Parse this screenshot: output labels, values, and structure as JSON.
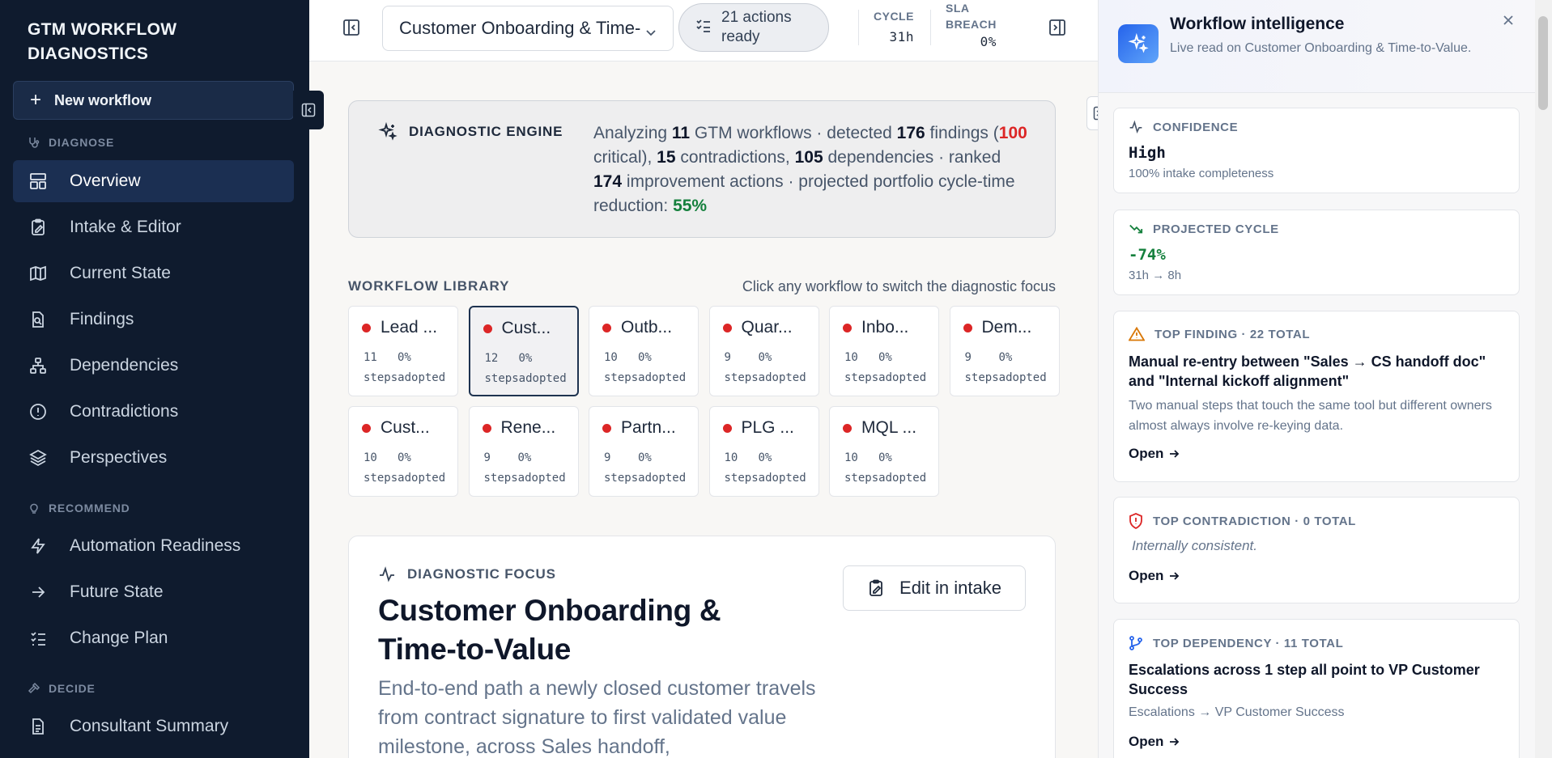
{
  "sidebar": {
    "brand_line1": "GTM WORKFLOW",
    "brand_line2": "DIAGNOSTICS",
    "new_workflow": "New workflow",
    "sections": {
      "diagnose": "DIAGNOSE",
      "recommend": "RECOMMEND",
      "decide": "DECIDE"
    },
    "items": {
      "overview": "Overview",
      "intake": "Intake & Editor",
      "current_state": "Current State",
      "findings": "Findings",
      "dependencies": "Dependencies",
      "contradictions": "Contradictions",
      "perspectives": "Perspectives",
      "automation": "Automation Readiness",
      "future_state": "Future State",
      "change_plan": "Change Plan",
      "consultant_summary": "Consultant Summary"
    }
  },
  "topbar": {
    "workflow_select": "Customer Onboarding & Time-",
    "actions_line1": "21 actions",
    "actions_line2": "ready",
    "cycle_label": "CYCLE",
    "cycle_value": "31h",
    "sla_label_1": "SLA",
    "sla_label_2": "BREACH",
    "sla_value": "0%"
  },
  "engine": {
    "label": "DIAGNOSTIC ENGINE",
    "t1": "Analyzing ",
    "workflows": "11",
    "t2": " GTM workflows · detected ",
    "findings": "176",
    "t3": " findings (",
    "critical": "100",
    "t4": " critical), ",
    "contradictions": "15",
    "t5": " contradictions, ",
    "dependencies": "105",
    "t6": " dependencies · ranked ",
    "actions": "174",
    "t7": " improvement actions · projected portfolio cycle-time reduction: ",
    "reduction": "55%"
  },
  "library": {
    "heading": "WORKFLOW LIBRARY",
    "hint": "Click any workflow to switch the diagnostic focus",
    "steps_label": "steps",
    "adopted_label": "adopted",
    "cards": [
      {
        "name": "Lead ...",
        "steps": "11",
        "adopted": "0%"
      },
      {
        "name": "Cust...",
        "steps": "12",
        "adopted": "0%"
      },
      {
        "name": "Outb...",
        "steps": "10",
        "adopted": "0%"
      },
      {
        "name": "Quar...",
        "steps": "9",
        "adopted": "0%"
      },
      {
        "name": "Inbo...",
        "steps": "10",
        "adopted": "0%"
      },
      {
        "name": "Dem...",
        "steps": "9",
        "adopted": "0%"
      },
      {
        "name": "Cust...",
        "steps": "10",
        "adopted": "0%"
      },
      {
        "name": "Rene...",
        "steps": "9",
        "adopted": "0%"
      },
      {
        "name": "Partn...",
        "steps": "9",
        "adopted": "0%"
      },
      {
        "name": "PLG ...",
        "steps": "10",
        "adopted": "0%"
      },
      {
        "name": "MQL ...",
        "steps": "10",
        "adopted": "0%"
      }
    ]
  },
  "focus": {
    "label": "DIAGNOSTIC FOCUS",
    "title": "Customer Onboarding & Time-to-Value",
    "description": "End-to-end path a newly closed customer travels from contract signature to first validated value milestone, across Sales handoff,",
    "edit_button": "Edit in intake"
  },
  "panel": {
    "title": "Workflow intelligence",
    "subtitle": "Live read on Customer Onboarding & Time-to-Value.",
    "confidence_label": "CONFIDENCE",
    "confidence_value": "High",
    "confidence_note": "100% intake completeness",
    "projected_label": "PROJECTED CYCLE",
    "projected_value": "-74%",
    "projected_note": "31h → 8h",
    "finding_label": "TOP FINDING · 22 TOTAL",
    "finding_title": "Manual re-entry between \"Sales → CS handoff doc\" and \"Internal kickoff alignment\"",
    "finding_body": "Two manual steps that touch the same tool but different owners almost always involve re-keying data.",
    "contradiction_label": "TOP CONTRADICTION · 0 TOTAL",
    "contradiction_body": "Internally consistent.",
    "dependency_label": "TOP DEPENDENCY · 11 TOTAL",
    "dependency_title": "Escalations across 1 step all point to VP Customer Success",
    "dependency_body": "Escalations → VP Customer Success",
    "open_label": "Open"
  }
}
